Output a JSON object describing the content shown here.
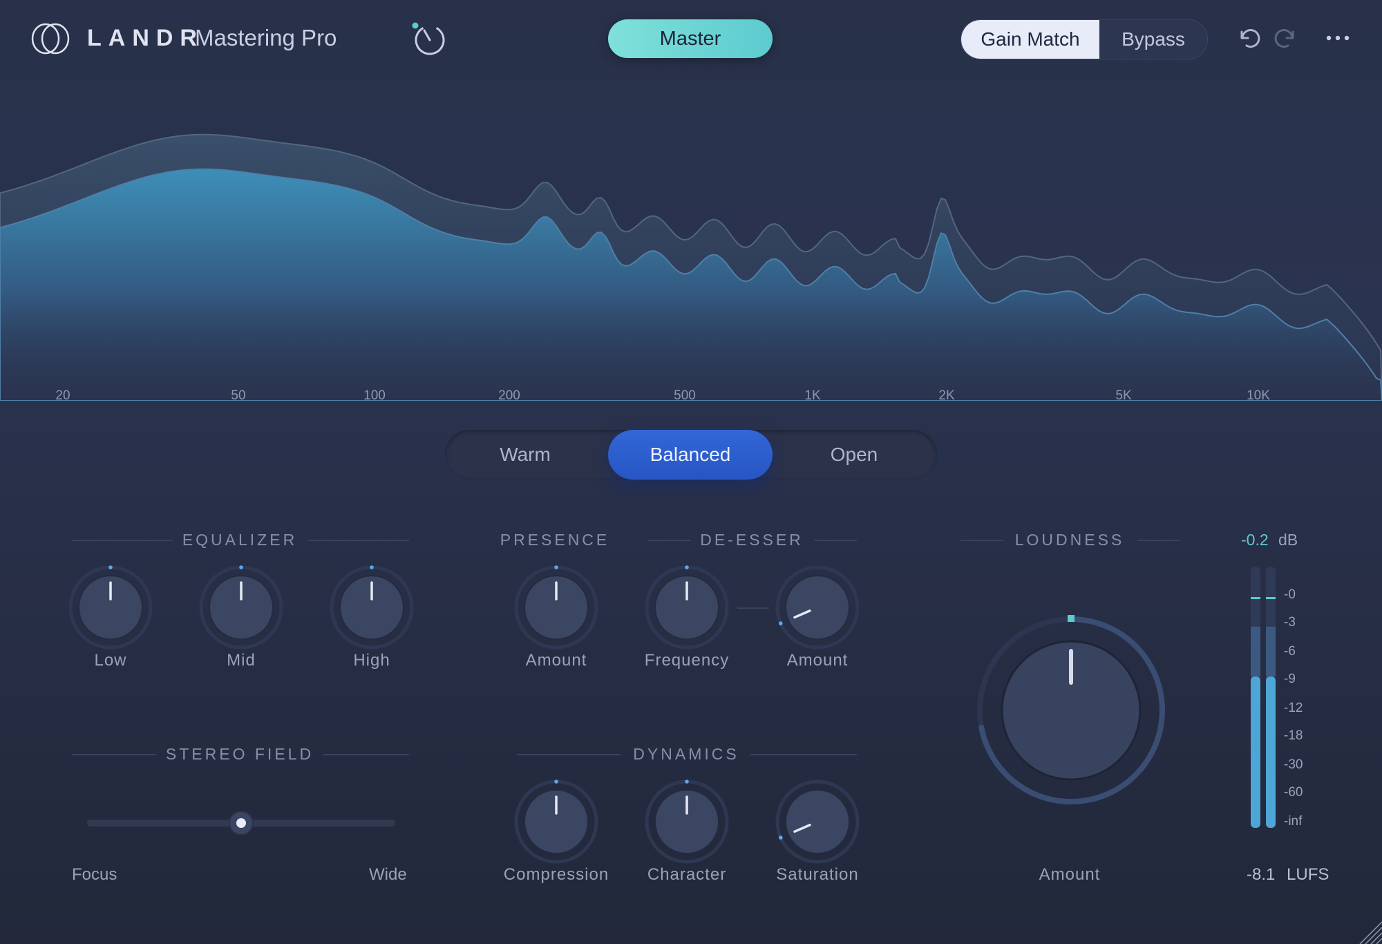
{
  "header": {
    "brand": "LANDR",
    "product": "Mastering Pro",
    "master_label": "Master",
    "gain_match_label": "Gain Match",
    "bypass_label": "Bypass",
    "icons": [
      "logo-icon",
      "dial-icon",
      "undo-icon",
      "redo-icon",
      "more-icon"
    ]
  },
  "spectrum": {
    "freq_labels": [
      "20",
      "50",
      "100",
      "200",
      "500",
      "1K",
      "2K",
      "5K",
      "10K"
    ]
  },
  "tone": {
    "options": [
      "Warm",
      "Balanced",
      "Open"
    ],
    "selected": "Balanced"
  },
  "equalizer": {
    "title": "EQUALIZER",
    "knobs": [
      {
        "label": "Low",
        "value": 0.5
      },
      {
        "label": "Mid",
        "value": 0.5
      },
      {
        "label": "High",
        "value": 0.5
      }
    ]
  },
  "presence": {
    "title": "PRESENCE",
    "knobs": [
      {
        "label": "Amount",
        "value": 0.5
      }
    ]
  },
  "deesser": {
    "title": "DE-ESSER",
    "knobs": [
      {
        "label": "Frequency",
        "value": 0.5
      },
      {
        "label": "Amount",
        "value": 0.08
      }
    ]
  },
  "stereo": {
    "title": "STEREO FIELD",
    "left_label": "Focus",
    "right_label": "Wide",
    "value": 0.5
  },
  "dynamics": {
    "title": "DYNAMICS",
    "knobs": [
      {
        "label": "Compression",
        "value": 0.5
      },
      {
        "label": "Character",
        "value": 0.5
      },
      {
        "label": "Saturation",
        "value": 0.08
      }
    ]
  },
  "loudness": {
    "title": "LOUDNESS",
    "knob_label": "Amount",
    "value": 0.5,
    "arc_fraction": 0.72
  },
  "meter": {
    "peak_value": "-0.2",
    "peak_unit": "dB",
    "scale": [
      "-0",
      "-3",
      "-6",
      "-9",
      "-12",
      "-18",
      "-30",
      "-60",
      "-inf"
    ],
    "lufs_value": "-8.1",
    "lufs_unit": "LUFS",
    "level_fraction": 0.58
  },
  "colors": {
    "accent_teal": "#5ccbd0",
    "accent_blue": "#2f63d4",
    "background": "#283149"
  }
}
